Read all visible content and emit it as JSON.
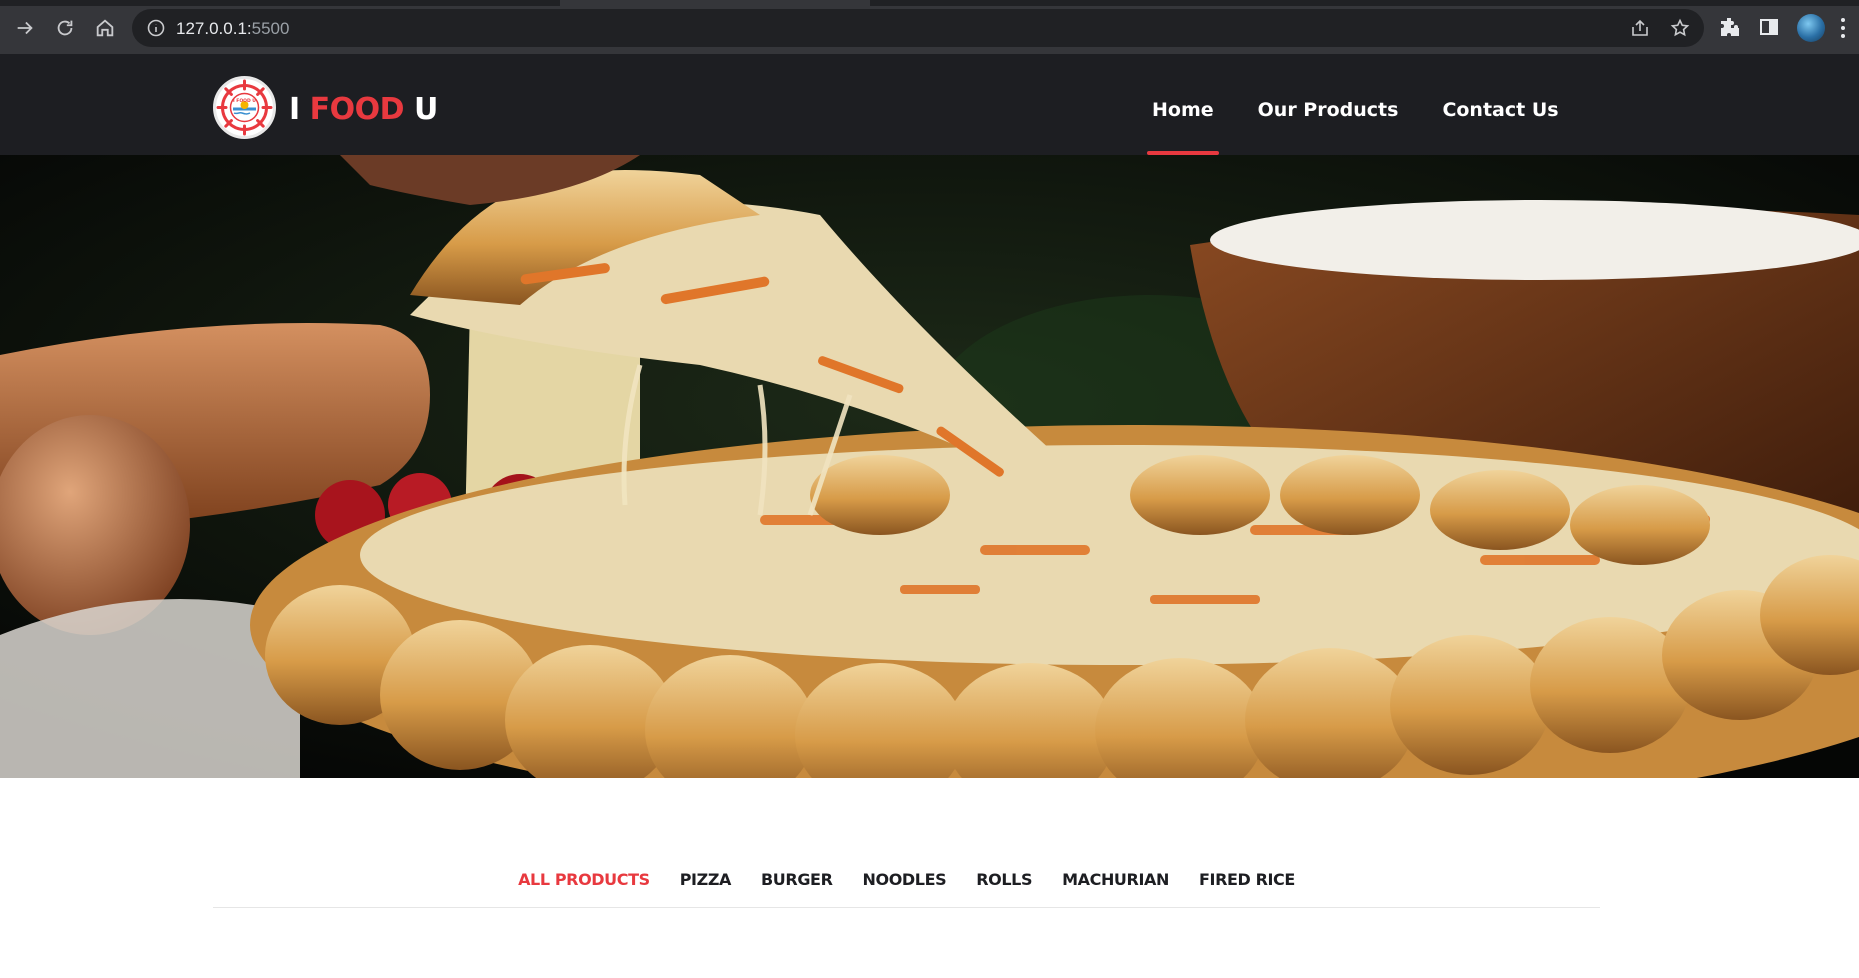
{
  "browser": {
    "url_host": "127.0.0.1:",
    "url_port": "5500"
  },
  "site": {
    "brand_prefix": "I",
    "brand_accent": "FOOD",
    "brand_suffix": "U",
    "logo_text": "I FOOD U",
    "accent_color": "#e8393f",
    "header_bg": "#1d1e22"
  },
  "nav": {
    "items": [
      {
        "label": "Home",
        "active": true
      },
      {
        "label": "Our Products",
        "active": false
      },
      {
        "label": "Contact Us",
        "active": false
      }
    ]
  },
  "filters": {
    "items": [
      {
        "label": "ALL PRODUCTS",
        "active": true
      },
      {
        "label": "PIZZA",
        "active": false
      },
      {
        "label": "BURGER",
        "active": false
      },
      {
        "label": "NOODLES",
        "active": false
      },
      {
        "label": "ROLLS",
        "active": false
      },
      {
        "label": "MACHURIAN",
        "active": false
      },
      {
        "label": "FIRED RICE",
        "active": false
      }
    ]
  }
}
